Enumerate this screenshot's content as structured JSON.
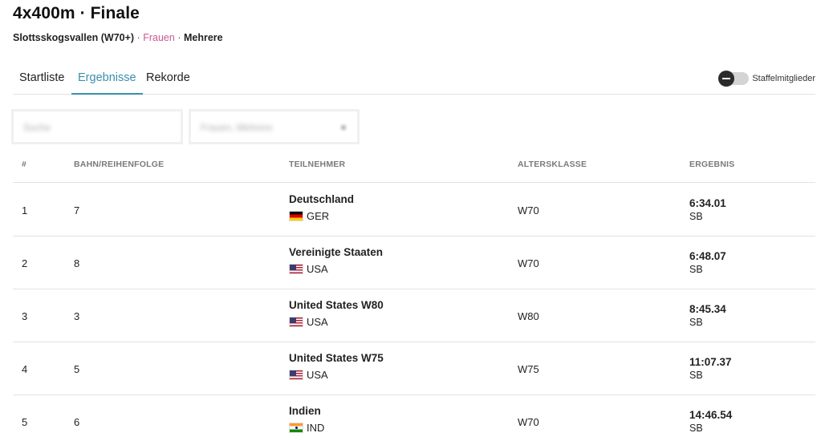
{
  "header": {
    "title": "4x400m · Finale",
    "venue": "Slottsskogsvallen (W70+)",
    "sep1": "·",
    "gender": "Frauen",
    "sep2": "·",
    "category": "Mehrere",
    "gender_color": "#c75a96"
  },
  "tabs": [
    {
      "label": "Startliste",
      "active": false
    },
    {
      "label": "Ergebnisse",
      "active": true
    },
    {
      "label": "Rekorde",
      "active": false
    }
  ],
  "accent_color": "#3a8fae",
  "toggle": {
    "label": "Staffelmitglieder",
    "on": false
  },
  "filters": {
    "search_placeholder": "Suche",
    "select_value": "Frauen, Mehrere"
  },
  "table": {
    "headers": [
      "#",
      "BAHN/REIHENFOLGE",
      "TEILNEHMER",
      "ALTERSKLASSE",
      "ERGEBNIS"
    ],
    "rows": [
      {
        "rank": "1",
        "lane": "7",
        "name": "Deutschland",
        "flag": "flag-ger",
        "nat": "GER",
        "age": "W70",
        "time": "6:34.01",
        "note": "SB"
      },
      {
        "rank": "2",
        "lane": "8",
        "name": "Vereinigte Staaten",
        "flag": "flag-usa",
        "nat": "USA",
        "age": "W70",
        "time": "6:48.07",
        "note": "SB"
      },
      {
        "rank": "3",
        "lane": "3",
        "name": "United States W80",
        "flag": "flag-usa",
        "nat": "USA",
        "age": "W80",
        "time": "8:45.34",
        "note": "SB"
      },
      {
        "rank": "4",
        "lane": "5",
        "name": "United States W75",
        "flag": "flag-usa",
        "nat": "USA",
        "age": "W75",
        "time": "11:07.37",
        "note": "SB"
      },
      {
        "rank": "5",
        "lane": "6",
        "name": "Indien",
        "flag": "flag-ind",
        "nat": "IND",
        "age": "W70",
        "time": "14:46.54",
        "note": "SB"
      }
    ]
  }
}
